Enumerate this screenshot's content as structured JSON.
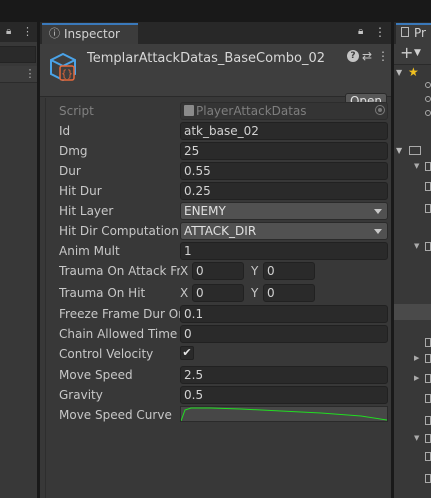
{
  "left_panel": {
    "lock_icon": "lock-icon",
    "menu_icon": "vertical-dots-icon"
  },
  "inspector": {
    "tab_label": "Inspector",
    "asset_title": "TemplarAttackDatas_BaseCombo_02",
    "open_button": "Open",
    "script": {
      "label": "Script",
      "value": "PlayerAttackDatas"
    },
    "fields": {
      "id": {
        "label": "Id",
        "value": "atk_base_02"
      },
      "dmg": {
        "label": "Dmg",
        "value": "25"
      },
      "dur": {
        "label": "Dur",
        "value": "0.55"
      },
      "hit_dur": {
        "label": "Hit Dur",
        "value": "0.25"
      },
      "hit_layer": {
        "label": "Hit Layer",
        "value": "ENEMY"
      },
      "hit_dir": {
        "label": "Hit Dir Computation T",
        "value": "ATTACK_DIR"
      },
      "anim_mult": {
        "label": "Anim Mult",
        "value": "1"
      },
      "trauma_attack": {
        "label": "Trauma On Attack Fra",
        "x_label": "X",
        "x": "0",
        "y_label": "Y",
        "y": "0"
      },
      "trauma_hit": {
        "label": "Trauma On Hit",
        "x_label": "X",
        "x": "0",
        "y_label": "Y",
        "y": "0"
      },
      "freeze": {
        "label": "Freeze Frame Dur On",
        "value": "0.1"
      },
      "chain": {
        "label": "Chain Allowed Time",
        "value": "0"
      },
      "control_velocity": {
        "label": "Control Velocity",
        "checked": true,
        "mark": "✔"
      },
      "move_speed": {
        "label": "Move Speed",
        "value": "2.5"
      },
      "gravity": {
        "label": "Gravity",
        "value": "0.5"
      },
      "move_speed_curve": {
        "label": "Move Speed Curve",
        "curve_color": "#22dd22"
      }
    },
    "colors": {
      "accent": "#3a79bb",
      "asset_icon": "#4aa3e8",
      "asset_icon_inner": "#e5683a"
    }
  },
  "right_panel": {
    "tab_label": "Pr",
    "add_icon": "plus-icon"
  }
}
